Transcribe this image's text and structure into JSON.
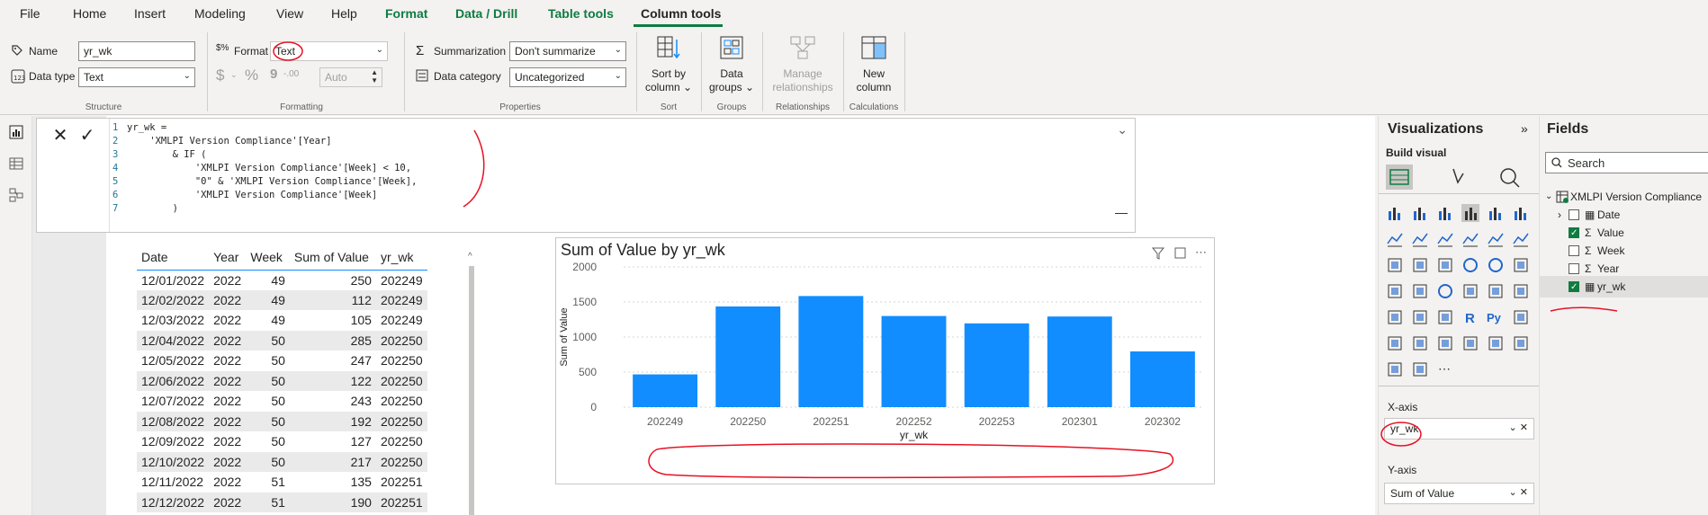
{
  "menu": {
    "file": "File",
    "home": "Home",
    "insert": "Insert",
    "modeling": "Modeling",
    "view": "View",
    "help": "Help",
    "format": "Format",
    "data_drill": "Data / Drill",
    "table_tools": "Table tools",
    "column_tools": "Column tools"
  },
  "ribbon": {
    "structure": {
      "name_label": "Name",
      "name_value": "yr_wk",
      "datatype_label": "Data type",
      "datatype_value": "Text",
      "group_label": "Structure"
    },
    "formatting": {
      "format_label": "Format",
      "format_value": "Text",
      "currency_symbol": "$",
      "percent_symbol": "%",
      "comma_symbol": "9",
      "decimals_symbol": "-.00",
      "decimal_places_value": "Auto",
      "group_label": "Formatting"
    },
    "properties": {
      "summarization_label": "Summarization",
      "summarization_value": "Don't summarize",
      "category_label": "Data category",
      "category_value": "Uncategorized",
      "group_label": "Properties"
    },
    "sort": {
      "button_label": "Sort by column",
      "line1": "Sort by",
      "line2": "column",
      "group_label": "Sort"
    },
    "groups": {
      "line1": "Data",
      "line2": "groups",
      "group_label": "Groups"
    },
    "relationships": {
      "line1": "Manage",
      "line2": "relationships",
      "group_label": "Relationships"
    },
    "calculations": {
      "line1": "New",
      "line2": "column",
      "group_label": "Calculations"
    }
  },
  "formula": {
    "lines": [
      {
        "n": "1",
        "text": "yr_wk ="
      },
      {
        "n": "2",
        "text": "    'XMLPI Version Compliance'[Year]"
      },
      {
        "n": "3",
        "text": "        & IF ("
      },
      {
        "n": "4",
        "text": "            'XMLPI Version Compliance'[Week] < 10,"
      },
      {
        "n": "5",
        "text": "            \"0\" & 'XMLPI Version Compliance'[Week],"
      },
      {
        "n": "6",
        "text": "            'XMLPI Version Compliance'[Week]"
      },
      {
        "n": "7",
        "text": "        )"
      }
    ]
  },
  "table": {
    "headers": [
      "Date",
      "Year",
      "Week",
      "Sum of Value",
      "yr_wk"
    ],
    "rows": [
      [
        "12/01/2022",
        "2022",
        "49",
        "250",
        "202249"
      ],
      [
        "12/02/2022",
        "2022",
        "49",
        "112",
        "202249"
      ],
      [
        "12/03/2022",
        "2022",
        "49",
        "105",
        "202249"
      ],
      [
        "12/04/2022",
        "2022",
        "50",
        "285",
        "202250"
      ],
      [
        "12/05/2022",
        "2022",
        "50",
        "247",
        "202250"
      ],
      [
        "12/06/2022",
        "2022",
        "50",
        "122",
        "202250"
      ],
      [
        "12/07/2022",
        "2022",
        "50",
        "243",
        "202250"
      ],
      [
        "12/08/2022",
        "2022",
        "50",
        "192",
        "202250"
      ],
      [
        "12/09/2022",
        "2022",
        "50",
        "127",
        "202250"
      ],
      [
        "12/10/2022",
        "2022",
        "50",
        "217",
        "202250"
      ],
      [
        "12/11/2022",
        "2022",
        "51",
        "135",
        "202251"
      ],
      [
        "12/12/2022",
        "2022",
        "51",
        "190",
        "202251"
      ]
    ]
  },
  "chart_data": {
    "type": "bar",
    "title": "Sum of Value by yr_wk",
    "xlabel": "yr_wk",
    "ylabel": "Sum of Value",
    "categories": [
      "202249",
      "202250",
      "202251",
      "202252",
      "202253",
      "202301",
      "202302"
    ],
    "values": [
      467,
      1436,
      1585,
      1300,
      1195,
      1293,
      795
    ],
    "ylim": [
      0,
      2000
    ],
    "yticks": [
      0,
      500,
      1000,
      1500,
      2000
    ],
    "grid": true,
    "bar_color": "#118dff"
  },
  "visualizations": {
    "title": "Visualizations",
    "build_visual": "Build visual",
    "xaxis_label": "X-axis",
    "xaxis_value": "yr_wk",
    "yaxis_label": "Y-axis",
    "yaxis_value": "Sum of Value"
  },
  "fields": {
    "title": "Fields",
    "search_placeholder": "Search",
    "table_name": "XMLPI Version Compliance",
    "items": [
      {
        "name": "Date",
        "checked": false
      },
      {
        "name": "Value",
        "checked": true
      },
      {
        "name": "Week",
        "checked": false
      },
      {
        "name": "Year",
        "checked": false
      },
      {
        "name": "yr_wk",
        "checked": true
      }
    ]
  },
  "colors": {
    "accent": "#107c41",
    "bar": "#118dff",
    "annotation": "#e81123"
  }
}
